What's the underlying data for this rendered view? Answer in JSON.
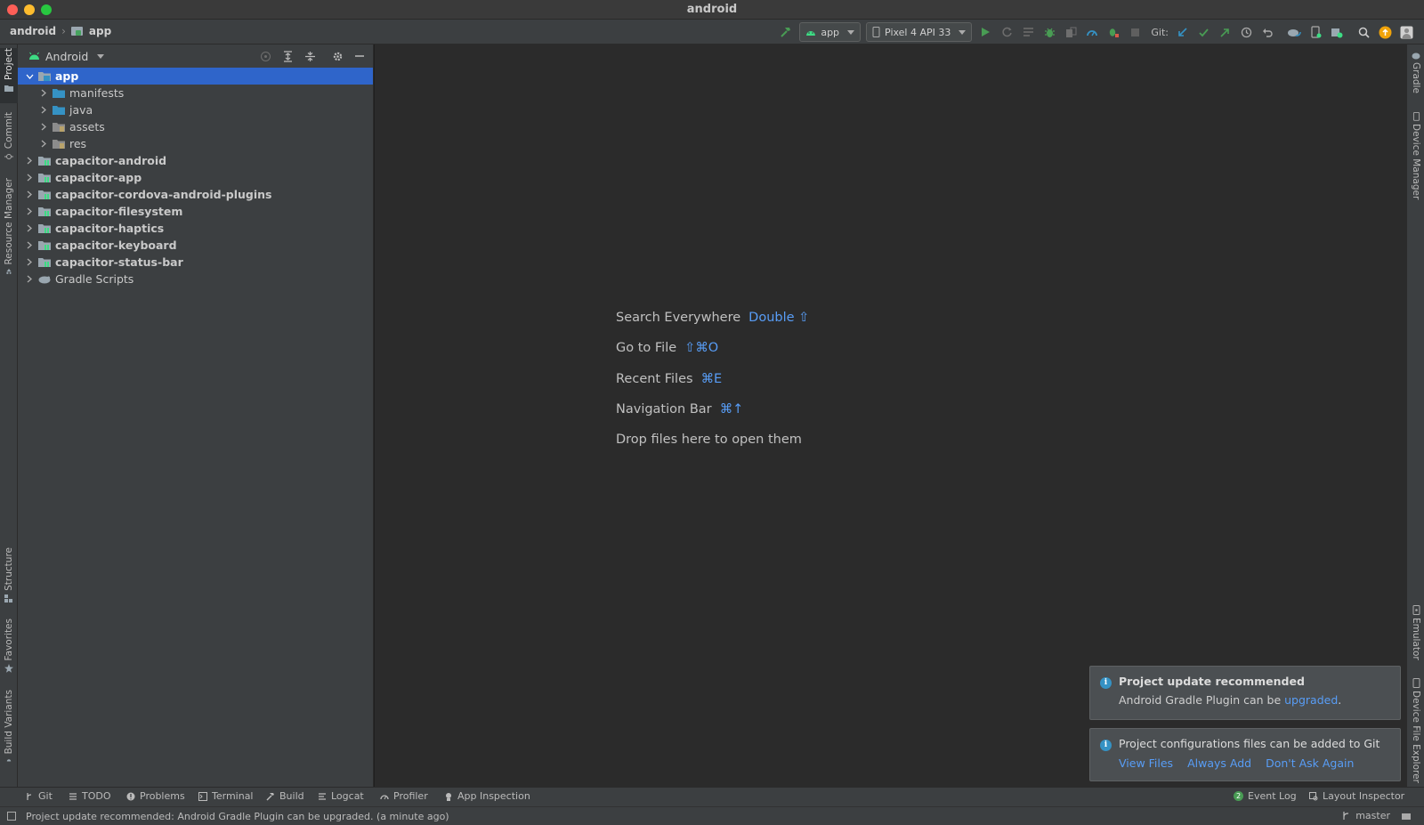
{
  "window": {
    "title": "android"
  },
  "breadcrumb": {
    "root": "android",
    "module": "app"
  },
  "toolbar": {
    "run_config": "app",
    "device": "Pixel 4 API 33",
    "git_label": "Git:"
  },
  "project_panel": {
    "view_mode": "Android",
    "tree": [
      {
        "label": "app",
        "level": 0,
        "bold": true,
        "expanded": true,
        "selected": true,
        "icon": "module-folder-icon"
      },
      {
        "label": "manifests",
        "level": 1,
        "bold": false,
        "expanded": false,
        "icon": "folder-icon"
      },
      {
        "label": "java",
        "level": 1,
        "bold": false,
        "expanded": false,
        "icon": "folder-icon"
      },
      {
        "label": "assets",
        "level": 1,
        "bold": false,
        "expanded": false,
        "icon": "resource-folder-icon"
      },
      {
        "label": "res",
        "level": 1,
        "bold": false,
        "expanded": false,
        "icon": "resource-folder-icon"
      },
      {
        "label": "capacitor-android",
        "level": 0,
        "bold": true,
        "expanded": false,
        "icon": "library-module-icon"
      },
      {
        "label": "capacitor-app",
        "level": 0,
        "bold": true,
        "expanded": false,
        "icon": "library-module-icon"
      },
      {
        "label": "capacitor-cordova-android-plugins",
        "level": 0,
        "bold": true,
        "expanded": false,
        "icon": "library-module-icon"
      },
      {
        "label": "capacitor-filesystem",
        "level": 0,
        "bold": true,
        "expanded": false,
        "icon": "library-module-icon"
      },
      {
        "label": "capacitor-haptics",
        "level": 0,
        "bold": true,
        "expanded": false,
        "icon": "library-module-icon"
      },
      {
        "label": "capacitor-keyboard",
        "level": 0,
        "bold": true,
        "expanded": false,
        "icon": "library-module-icon"
      },
      {
        "label": "capacitor-status-bar",
        "level": 0,
        "bold": true,
        "expanded": false,
        "icon": "library-module-icon"
      },
      {
        "label": "Gradle Scripts",
        "level": 0,
        "bold": false,
        "expanded": false,
        "icon": "gradle-icon"
      }
    ]
  },
  "left_tabs": {
    "project": "Project",
    "commit": "Commit",
    "resource_manager": "Resource Manager",
    "structure": "Structure",
    "favorites": "Favorites",
    "build_variants": "Build Variants"
  },
  "right_tabs": {
    "gradle": "Gradle",
    "device_manager": "Device Manager",
    "emulator": "Emulator",
    "device_file_explorer": "Device File Explorer"
  },
  "editor_hints": [
    {
      "label": "Search Everywhere",
      "shortcut": "Double ⇧"
    },
    {
      "label": "Go to File",
      "shortcut": "⇧⌘O"
    },
    {
      "label": "Recent Files",
      "shortcut": "⌘E"
    },
    {
      "label": "Navigation Bar",
      "shortcut": "⌘↑"
    },
    {
      "label": "Drop files here to open them",
      "shortcut": ""
    }
  ],
  "notifications": {
    "update": {
      "title": "Project update recommended",
      "body_prefix": "Android Gradle Plugin can be ",
      "body_link": "upgraded",
      "body_suffix": "."
    },
    "git": {
      "title": "Project configurations files can be added to Git",
      "actions": [
        "View Files",
        "Always Add",
        "Don't Ask Again"
      ]
    }
  },
  "bottom_tabs": {
    "git": "Git",
    "todo": "TODO",
    "problems": "Problems",
    "terminal": "Terminal",
    "build": "Build",
    "logcat": "Logcat",
    "profiler": "Profiler",
    "app_inspection": "App Inspection",
    "event_log": "Event Log",
    "event_log_count": "2",
    "layout_inspector": "Layout Inspector"
  },
  "status_bar": {
    "message": "Project update recommended: Android Gradle Plugin can be upgraded. (a minute ago)",
    "branch": "master"
  },
  "colors": {
    "selection": "#2f65ca",
    "link": "#589df6",
    "android_green": "#3ddc84",
    "run_green": "#499c54",
    "info_blue": "#3592c4",
    "update_orange": "#f0a30a"
  }
}
